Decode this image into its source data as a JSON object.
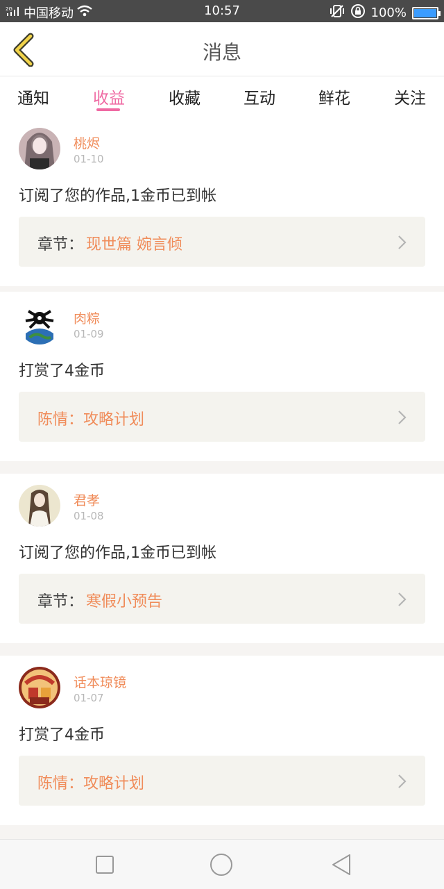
{
  "status": {
    "carrier": "中国移动",
    "net": "2G",
    "time": "10:57",
    "battery": "100%",
    "battery_level": 1.0,
    "accent": "#3b9cff"
  },
  "header": {
    "title": "消息",
    "back_icon": "chevron-left-icon"
  },
  "tabs": [
    {
      "label": "通知",
      "active": false
    },
    {
      "label": "收益",
      "active": true
    },
    {
      "label": "收藏",
      "active": false
    },
    {
      "label": "互动",
      "active": false
    },
    {
      "label": "鲜花",
      "active": false
    },
    {
      "label": "关注",
      "active": false
    }
  ],
  "colors": {
    "tab_active": "#ef6aa3",
    "name": "#f08c5a",
    "link": "#f08c5a"
  },
  "items": [
    {
      "name": "桃烬",
      "date": "01-10",
      "message": "订阅了您的作品,1金币已到帐",
      "ref_prefix": "章节：",
      "ref_text": "现世篇 婉言倾",
      "avatar": "avatar-girl"
    },
    {
      "name": "肉粽",
      "date": "01-09",
      "message": "打赏了4金币",
      "ref_prefix": "",
      "ref_text": "陈情：攻略计划",
      "avatar": "avatar-bird-globe"
    },
    {
      "name": "君孝",
      "date": "01-08",
      "message": "订阅了您的作品,1金币已到帐",
      "ref_prefix": "章节：",
      "ref_text": "寒假小预告",
      "avatar": "avatar-long-hair"
    },
    {
      "name": "话本琼镜",
      "date": "01-07",
      "message": "打赏了4金币",
      "ref_prefix": "",
      "ref_text": "陈情：攻略计划",
      "avatar": "avatar-cartoon"
    }
  ],
  "navbar": {
    "buttons": [
      "square-icon",
      "circle-icon",
      "back-triangle-icon"
    ]
  }
}
